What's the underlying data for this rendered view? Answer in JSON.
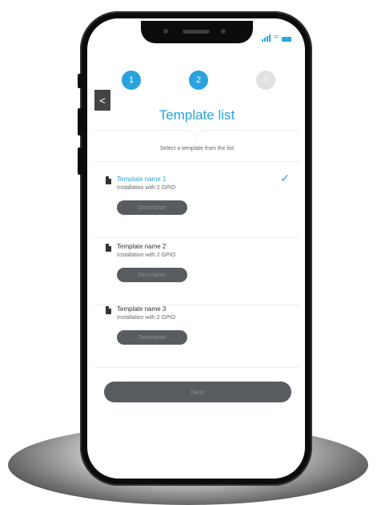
{
  "status_bar": {
    "signal_icon": "signal-icon",
    "wifi_icon": "wifi-icon",
    "battery_icon": "battery-icon"
  },
  "steps": [
    {
      "label": "1",
      "state": "done"
    },
    {
      "label": "2",
      "state": "active"
    },
    {
      "label": "3",
      "state": "todo"
    }
  ],
  "header": {
    "back_icon": "chevron-left-icon",
    "back_glyph": "<",
    "title": "Template list"
  },
  "subtitle": "Select a template from the list",
  "templates": [
    {
      "name": "Template name 1",
      "description": "Installation with 2 GPIO",
      "button_label": "Description",
      "selected": true,
      "check_glyph": "✓"
    },
    {
      "name": "Template name 2",
      "description": "Installation with 2 GPIO",
      "button_label": "Description",
      "selected": false
    },
    {
      "name": "Template name 3",
      "description": "Installation with 2 GPIO",
      "button_label": "Description",
      "selected": false
    }
  ],
  "next_label": "Next",
  "colors": {
    "accent": "#29a3dd",
    "button": "#585b60",
    "button_text": "#8c9096",
    "inactive_step": "#e1e1e1"
  }
}
